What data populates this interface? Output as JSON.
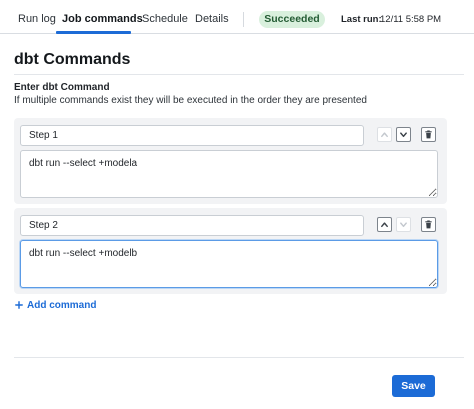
{
  "tabs": [
    {
      "label": "Run log"
    },
    {
      "label": "Job commands"
    },
    {
      "label": "Schedule"
    },
    {
      "label": "Details"
    }
  ],
  "status": {
    "label": "Succeeded"
  },
  "last_run": {
    "label": "Last run:",
    "value": "12/11 5:58 PM"
  },
  "page_title": "dbt Commands",
  "section": {
    "label": "Enter dbt Command",
    "help": "If multiple commands exist they will be executed in the order they are presented"
  },
  "commands": [
    {
      "name": "Step 1",
      "command": "dbt run --select +modela"
    },
    {
      "name": "Step 2",
      "command": "dbt run --select +modelb"
    }
  ],
  "add_command_label": "Add command",
  "save_label": "Save",
  "colors": {
    "accent": "#1c6bd6",
    "success_bg": "#d9f0dd",
    "success_text": "#245c34"
  }
}
